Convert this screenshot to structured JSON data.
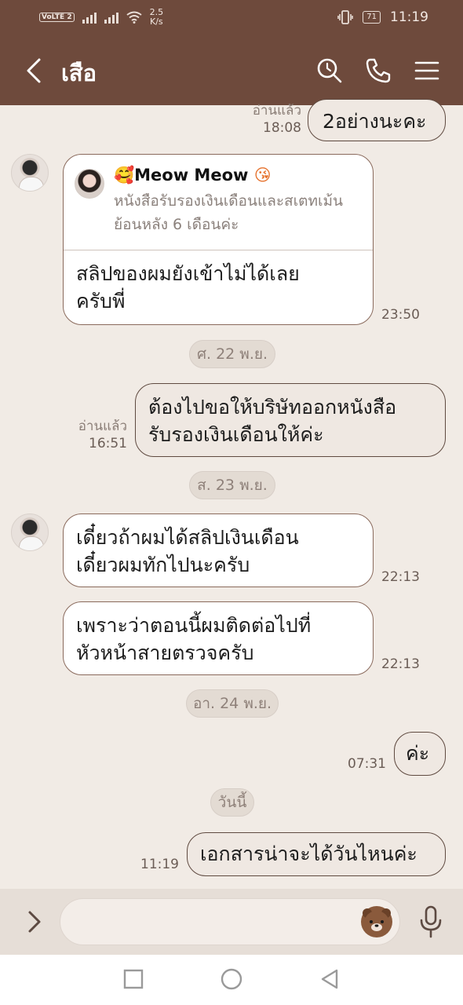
{
  "status_bar": {
    "volte": "VoLTE 2",
    "net_speed_value": "2.5",
    "net_speed_unit": "K/s",
    "battery": "71",
    "time": "11:19"
  },
  "header": {
    "title": "เสือ",
    "icons": [
      "back-icon",
      "search-icon",
      "phone-icon",
      "menu-icon"
    ]
  },
  "messages": {
    "top_out": {
      "text": "2อย่างนะคะ",
      "read": "อ่านแล้ว",
      "time": "18:08"
    },
    "reply_msg": {
      "quoted_name_emoji_left": "🥰",
      "quoted_name": "Meow Meow",
      "quoted_name_emoji_right": "😘",
      "quoted_text": "หนังสือรับรองเงินเดือนและสเตทเม้นย้อนหลัง 6 เดือนค่ะ",
      "body_line1": "สลิปของผมยังเข้าไม่ได้เลย",
      "body_line2": "ครับพี่",
      "time": "23:50"
    },
    "date1": "ศ. 22 พ.ย.",
    "out1": {
      "line1": "ต้องไปขอให้บริษัทออกหนังสือ",
      "line2": "รับรองเงินเดือนให้ค่ะ",
      "read": "อ่านแล้ว",
      "time": "16:51"
    },
    "date2": "ส. 23 พ.ย.",
    "in2": {
      "line1": "เดี๋ยวถ้าผมได้สลิปเงินเดือน",
      "line2": "เดี๋ยวผมทักไปนะครับ",
      "time": "22:13"
    },
    "in3": {
      "line1": "เพราะว่าตอนนี้ผมติดต่อไปที่",
      "line2": "หัวหน้าสายตรวจครับ",
      "time": "22:13"
    },
    "date3": "อา. 24 พ.ย.",
    "out2": {
      "text": "ค่ะ",
      "time": "07:31"
    },
    "date4": "วันนี้",
    "out3": {
      "text": "เอกสารน่าจะได้วันไหนค่ะ",
      "time": "11:19"
    }
  },
  "input_bar": {
    "placeholder": ""
  },
  "colors": {
    "header": "#6e4a3c",
    "chat_bg": "#f1ebe5",
    "bubble_border": "#8a6a5c"
  }
}
